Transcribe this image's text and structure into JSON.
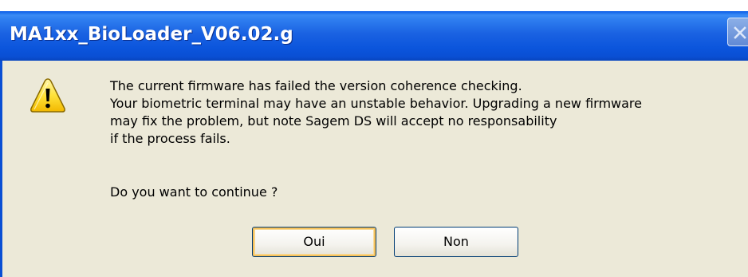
{
  "window": {
    "title": "MA1xx_BioLoader_V06.02.g",
    "title_bar_color": "#0a5ce8",
    "body_color": "#ece9d8"
  },
  "icon": {
    "name": "warning-icon"
  },
  "message": {
    "lines": [
      "The current firmware has failed the version coherence checking.",
      "Your biometric terminal may have an unstable behavior. Upgrading a new firmware",
      "may fix the problem, but note Sagem DS will accept no responsability",
      "if the process fails."
    ],
    "question": "Do you want to continue ?"
  },
  "buttons": {
    "yes_label": "Oui",
    "no_label": "Non"
  }
}
